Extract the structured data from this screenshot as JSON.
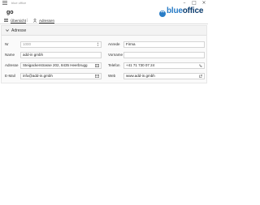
{
  "window": {
    "title": "blue office",
    "minimize_icon": "minimize-icon",
    "maximize_icon": "maximize-icon",
    "close_icon": "close-icon"
  },
  "app": {
    "title": "go",
    "logo": {
      "part1": "blue",
      "part2": "office"
    }
  },
  "tabs": [
    {
      "label": "Übersicht",
      "icon": "list-icon"
    },
    {
      "label": "Adressen",
      "icon": "person-icon"
    }
  ],
  "section": {
    "title": "Adresse",
    "fields": {
      "nr": {
        "label": "Nr",
        "value": "1000"
      },
      "anrede": {
        "label": "Anrede",
        "value": "Firma"
      },
      "name": {
        "label": "Name",
        "value": "add-in gmbh"
      },
      "vorname": {
        "label": "Vorname",
        "value": ""
      },
      "adresse": {
        "label": "Adresse",
        "value": "Steigackerstrasse 202, 8435 Heerbrugg"
      },
      "telefon": {
        "label": "Telefon",
        "value": "+41 71 730 07 24"
      },
      "email": {
        "label": "E-Mail",
        "value": "info@add-in.gmbh"
      },
      "web": {
        "label": "Web",
        "value": "www.add-in.gmbh"
      }
    }
  },
  "colors": {
    "accent_blue": "#2a7dc7",
    "dark_blue": "#0d3d6e"
  }
}
